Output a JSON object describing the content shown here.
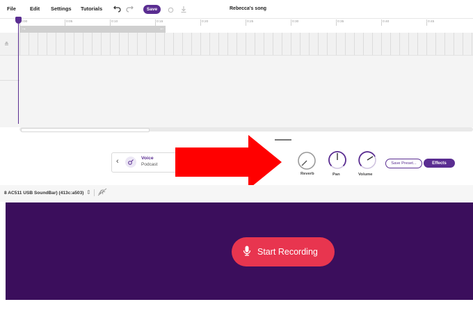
{
  "menu": {
    "file": "File",
    "edit": "Edit",
    "settings": "Settings",
    "tutorials": "Tutorials",
    "undo_icon": "undo-icon",
    "redo_icon": "redo-icon",
    "save": "Save",
    "download_icon": "download-icon"
  },
  "project": {
    "title": "Rebecca's song"
  },
  "timeline": {
    "ticks": [
      "0:00",
      "0:05",
      "0:10",
      "0:15",
      "0:20",
      "0:25",
      "0:30",
      "0:35",
      "0:40",
      "0:45"
    ]
  },
  "preset": {
    "name": "Voice",
    "category": "Podcast"
  },
  "effects": {
    "knobs": [
      {
        "label": "Reverb"
      },
      {
        "label": "Pan"
      },
      {
        "label": "Volume"
      }
    ],
    "save_preset": "Save Preset...",
    "effects_button": "Effects"
  },
  "device": {
    "name": "8 AC511 USB SoundBar) (413c:a503)"
  },
  "recording": {
    "button_label": "Start Recording"
  },
  "colors": {
    "brand_purple": "#5a2d91",
    "record_area": "#3b0e5c",
    "record_button": "#e8354f",
    "annotation_arrow": "#ff0000"
  }
}
